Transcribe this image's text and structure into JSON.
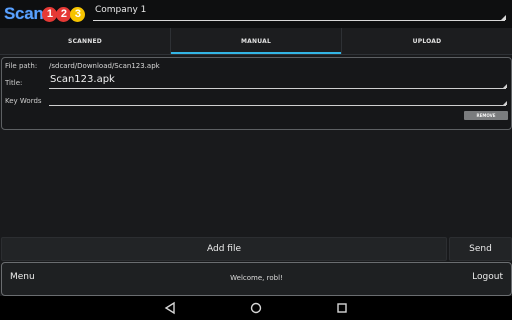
{
  "app": {
    "logo_text": "Scan",
    "logo_digits": [
      "1",
      "2",
      "3"
    ],
    "logo_digit_colors": [
      "#e53935",
      "#e53935",
      "#f6c400"
    ]
  },
  "company_select": {
    "value": "Company 1"
  },
  "tabs": [
    {
      "label": "SCANNED",
      "selected": false
    },
    {
      "label": "MANUAL",
      "selected": true
    },
    {
      "label": "UPLOAD",
      "selected": false
    }
  ],
  "form": {
    "file_path_label": "File path:",
    "file_path_value": "/sdcard/Download/Scan123.apk",
    "title_label": "Title:",
    "title_value": "Scan123.apk",
    "keywords_label": "Key Words",
    "keywords_value": "",
    "small_button_label": "REMOVE"
  },
  "actions": {
    "add_file_label": "Add file",
    "send_label": "Send"
  },
  "footer": {
    "menu_label": "Menu",
    "welcome_text": "Welcome, robl!",
    "logout_label": "Logout"
  },
  "navigation_bar": {
    "icons": [
      "back-icon",
      "home-icon",
      "recents-icon"
    ]
  },
  "colors": {
    "accent": "#33b5e5",
    "background": "#191a1c",
    "logo_blue": "#5aa2ff"
  }
}
